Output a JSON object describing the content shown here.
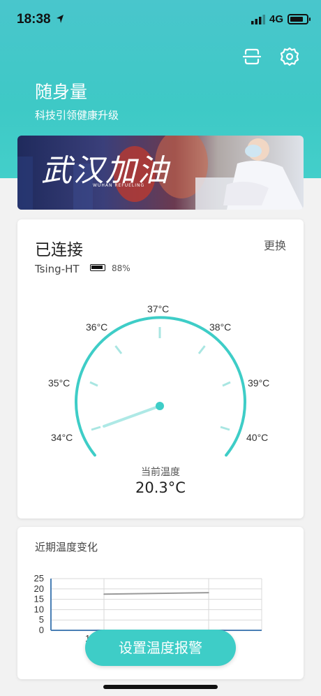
{
  "status_bar": {
    "time": "18:38",
    "network": "4G",
    "icons": [
      "location-arrow-icon",
      "signal-icon",
      "battery-icon"
    ]
  },
  "header": {
    "title": "随身量",
    "subtitle": "科技引领健康升级",
    "icons": [
      "scan-icon",
      "gear-icon"
    ]
  },
  "banner": {
    "text": "武汉加油",
    "subtext": "WUHAN REFUELING"
  },
  "device_card": {
    "status": "已连接",
    "change_label": "更换",
    "device_name": "Tsing-HT",
    "battery_pct": "88%",
    "gauge_labels": [
      "34°C",
      "35°C",
      "36°C",
      "37°C",
      "38°C",
      "39°C",
      "40°C"
    ],
    "current_label": "当前温度",
    "current_value": "20.3°C"
  },
  "chart_card": {
    "title": "近期温度变化"
  },
  "chart_data": {
    "type": "line",
    "y_ticks": [
      "25",
      "20",
      "15",
      "10",
      "5",
      "0"
    ],
    "ylim": [
      0,
      25
    ],
    "series": [
      {
        "values": [
          17.5,
          18.2
        ]
      }
    ],
    "x_tick_partial": "1"
  },
  "actions": {
    "alarm_label": "设置温度报警"
  },
  "colors": {
    "accent": "#3ecdc7",
    "header": "#49c6cc",
    "needle": "#aee9e6"
  }
}
